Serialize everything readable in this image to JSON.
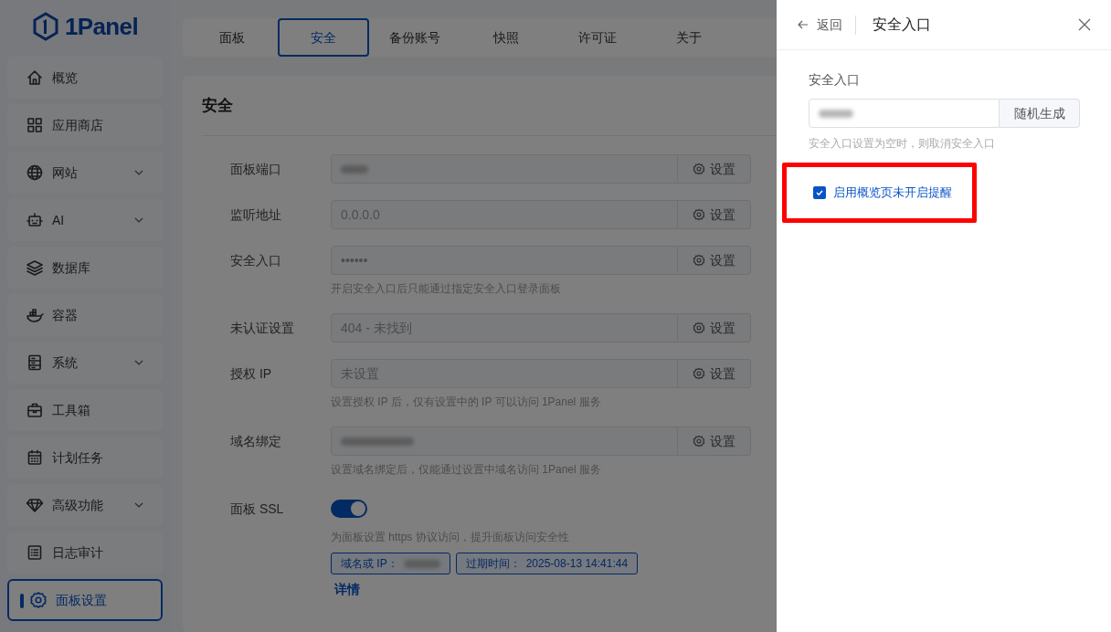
{
  "sidebar": {
    "logo": "1Panel",
    "items": [
      {
        "label": "概览",
        "expandable": false,
        "selected": false
      },
      {
        "label": "应用商店",
        "expandable": false,
        "selected": false
      },
      {
        "label": "网站",
        "expandable": true,
        "selected": false
      },
      {
        "label": "AI",
        "expandable": true,
        "selected": false
      },
      {
        "label": "数据库",
        "expandable": false,
        "selected": false
      },
      {
        "label": "容器",
        "expandable": false,
        "selected": false
      },
      {
        "label": "系统",
        "expandable": true,
        "selected": false
      },
      {
        "label": "工具箱",
        "expandable": false,
        "selected": false
      },
      {
        "label": "计划任务",
        "expandable": false,
        "selected": false
      },
      {
        "label": "高级功能",
        "expandable": true,
        "selected": false
      },
      {
        "label": "日志审计",
        "expandable": false,
        "selected": false
      },
      {
        "label": "面板设置",
        "expandable": false,
        "selected": true
      }
    ]
  },
  "tabs": [
    {
      "label": "面板",
      "selected": false
    },
    {
      "label": "安全",
      "selected": true
    },
    {
      "label": "备份账号",
      "selected": false
    },
    {
      "label": "快照",
      "selected": false
    },
    {
      "label": "许可证",
      "selected": false
    },
    {
      "label": "关于",
      "selected": false
    }
  ],
  "card": {
    "title": "安全",
    "rows": [
      {
        "kind": "input",
        "label": "面板端口",
        "redacted": true,
        "button": "设置"
      },
      {
        "kind": "input",
        "label": "监听地址",
        "value": "0.0.0.0",
        "button": "设置"
      },
      {
        "kind": "input",
        "label": "安全入口",
        "value": "••••••",
        "button": "设置",
        "hint": "开启安全入口后只能通过指定安全入口登录面板"
      },
      {
        "kind": "input",
        "label": "未认证设置",
        "value": "404 - 未找到",
        "button": "设置"
      },
      {
        "kind": "input",
        "label": "授权 IP",
        "value": "未设置",
        "button": "设置",
        "hint": "设置授权 IP 后，仅有设置中的 IP 可以访问 1Panel 服务"
      },
      {
        "kind": "input",
        "label": "域名绑定",
        "redacted": true,
        "button": "设置",
        "hint": "设置域名绑定后，仅能通过设置中域名访问 1Panel 服务"
      },
      {
        "kind": "switch",
        "label": "面板 SSL",
        "on": true,
        "hint": "为面板设置 https 协议访问，提升面板访问安全性",
        "tags": [
          {
            "label": "域名或 IP：",
            "redacted": true
          },
          {
            "label": "过期时间：",
            "value": "2025-08-13 14:41:44"
          }
        ],
        "link": "详情"
      }
    ]
  },
  "drawer": {
    "back": "返回",
    "title": "安全入口",
    "field_label": "安全入口",
    "field_redacted": true,
    "button": "随机生成",
    "hint": "安全入口设置为空时，则取消安全入口",
    "checkbox": {
      "label": "启用概览页未开启提醒",
      "checked": true,
      "highlighted": true
    }
  }
}
